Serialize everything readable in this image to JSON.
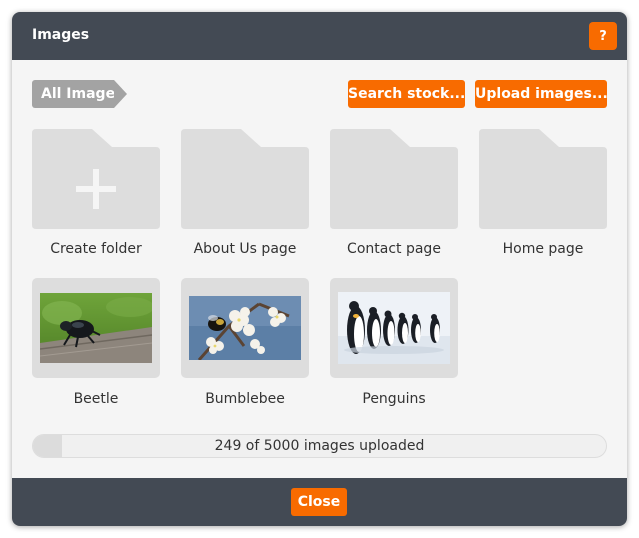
{
  "dialog": {
    "title": "Images",
    "help_label": "?"
  },
  "toolbar": {
    "breadcrumb": "All Images",
    "search_label": "Search stock...",
    "upload_label": "Upload images..."
  },
  "folders": [
    {
      "label": "Create folder",
      "icon": "folder-plus-icon"
    },
    {
      "label": "About Us page",
      "icon": "folder-icon"
    },
    {
      "label": "Contact page",
      "icon": "folder-icon"
    },
    {
      "label": "Home page",
      "icon": "folder-icon"
    }
  ],
  "images": [
    {
      "label": "Beetle"
    },
    {
      "label": "Bumblebee"
    },
    {
      "label": "Penguins"
    }
  ],
  "upload_status": {
    "text": "249 of 5000 images uploaded",
    "uploaded": 249,
    "total": 5000
  },
  "footer": {
    "close_label": "Close"
  },
  "colors": {
    "header": "#434a54",
    "accent": "#f86b00",
    "tile": "#dddddd",
    "background": "#f5f5f5"
  }
}
